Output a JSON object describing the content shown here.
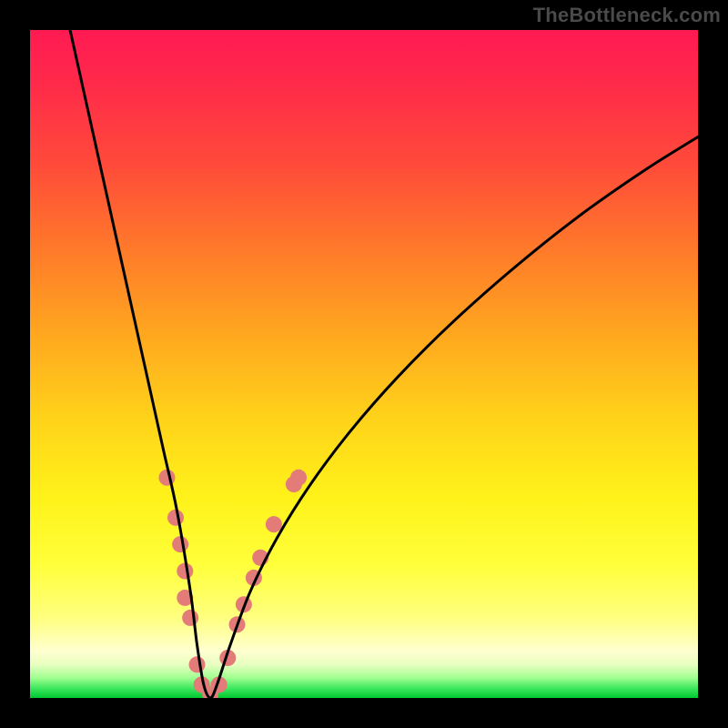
{
  "watermark": "TheBottleneck.com",
  "chart_data": {
    "type": "line",
    "title": "",
    "xlabel": "",
    "ylabel": "",
    "xlim": [
      0,
      100
    ],
    "ylim": [
      0,
      100
    ],
    "grid": false,
    "background_gradient": {
      "top": "#ff1a52",
      "middle": "#fff21a",
      "bottom": "#00c830"
    },
    "series": [
      {
        "name": "bottleneck-curve",
        "color": "#000000",
        "x": [
          6,
          8,
          10,
          12,
          14,
          16,
          18,
          20,
          22,
          24,
          25,
          26,
          27,
          28,
          30,
          33,
          37,
          42,
          48,
          55,
          63,
          72,
          82,
          92,
          100
        ],
        "y": [
          100,
          91,
          82,
          73,
          64,
          55,
          46,
          37,
          28,
          16,
          8,
          2,
          0,
          2,
          8,
          16,
          24,
          32,
          40,
          48,
          56,
          64,
          72,
          79,
          84
        ]
      }
    ],
    "markers": {
      "name": "highlight-points",
      "color": "#e37b78",
      "radius_px": 9,
      "points": [
        {
          "x": 20.5,
          "y": 33
        },
        {
          "x": 21.8,
          "y": 27
        },
        {
          "x": 22.5,
          "y": 23
        },
        {
          "x": 23.2,
          "y": 19
        },
        {
          "x": 23.2,
          "y": 15
        },
        {
          "x": 24.0,
          "y": 12
        },
        {
          "x": 25.0,
          "y": 5
        },
        {
          "x": 25.7,
          "y": 2
        },
        {
          "x": 27.0,
          "y": 0.5
        },
        {
          "x": 28.3,
          "y": 2
        },
        {
          "x": 29.6,
          "y": 6
        },
        {
          "x": 31.0,
          "y": 11
        },
        {
          "x": 32.0,
          "y": 14
        },
        {
          "x": 33.5,
          "y": 18
        },
        {
          "x": 34.5,
          "y": 21
        },
        {
          "x": 36.5,
          "y": 26
        },
        {
          "x": 39.5,
          "y": 32
        },
        {
          "x": 40.2,
          "y": 33
        }
      ]
    }
  }
}
